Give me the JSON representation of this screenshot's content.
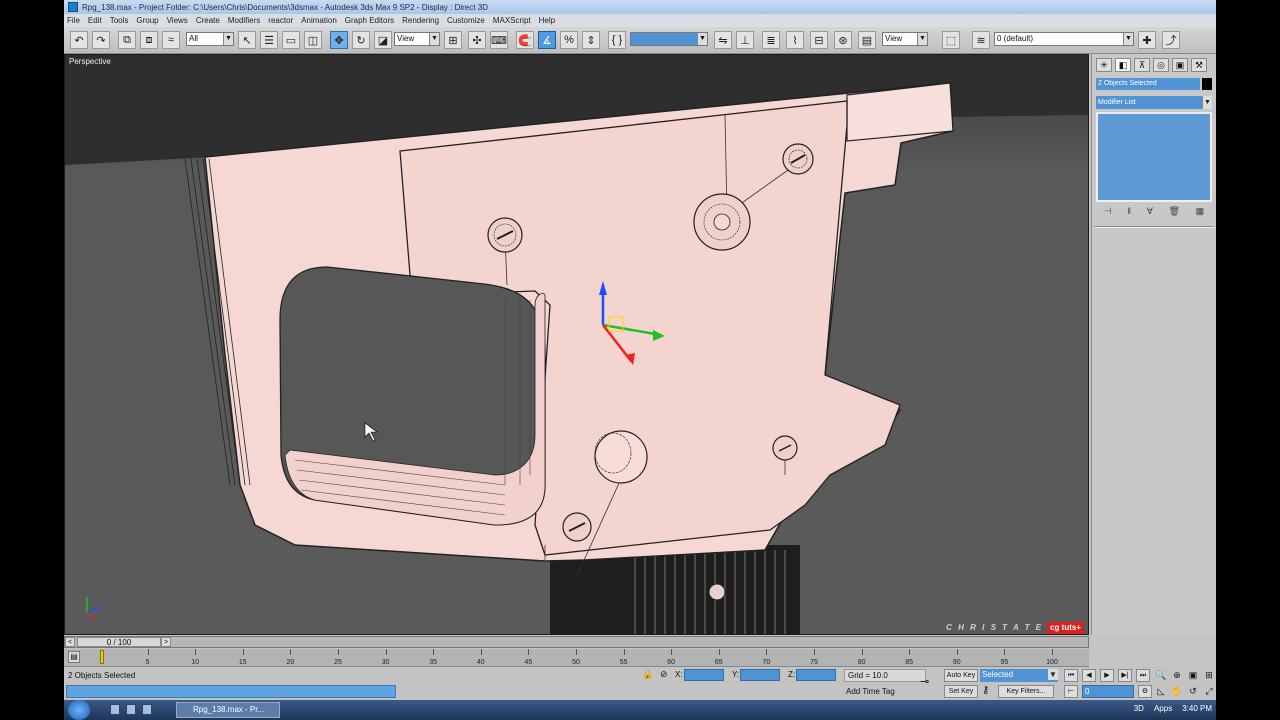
{
  "window": {
    "title": "Rpg_138.max    -    Project Folder: C:\\Users\\Chris\\Documents\\3dsmax    -    Autodesk 3ds Max 9 SP2    -    Display : Direct 3D"
  },
  "menu": [
    "File",
    "Edit",
    "Tools",
    "Group",
    "Views",
    "Create",
    "Modifiers",
    "reactor",
    "Animation",
    "Graph Editors",
    "Rendering",
    "Customize",
    "MAXScript",
    "Help"
  ],
  "toolbar": {
    "selection_filter": "All",
    "ref_coord": "View",
    "named_selection": "",
    "render_view": "View",
    "layer": "0 (default)"
  },
  "viewport": {
    "label": "Perspective",
    "watermark_name": "C H R I S   T A T E",
    "watermark_logo": "cg tuts+"
  },
  "command_panel": {
    "selection_name": "2 Objects Selected",
    "modifier_list": "Modifier List"
  },
  "time_slider": {
    "position": "0 / 100",
    "ticks": [
      5,
      10,
      15,
      20,
      25,
      30,
      35,
      40,
      45,
      50,
      55,
      60,
      65,
      70,
      75,
      80,
      85,
      90,
      95,
      100
    ]
  },
  "status": {
    "selection_info": "2 Objects Selected",
    "x_label": "X:",
    "y_label": "Y:",
    "z_label": "Z:",
    "grid": "Grid = 10.0",
    "add_time_tag": "Add Time Tag",
    "auto_key": "Auto Key",
    "set_key": "Set Key",
    "key_mode": "Selected",
    "key_filters": "Key Filters...",
    "current_frame": "0"
  },
  "taskbar": {
    "task_label": "Rpg_138.max  -  Pr...",
    "tray_items": [
      "3D",
      "Apps",
      "3:40 PM"
    ]
  },
  "colors": {
    "model": "#f5d8d3",
    "viewport_bg": "#575757",
    "selection_blue": "#4f93d4"
  }
}
